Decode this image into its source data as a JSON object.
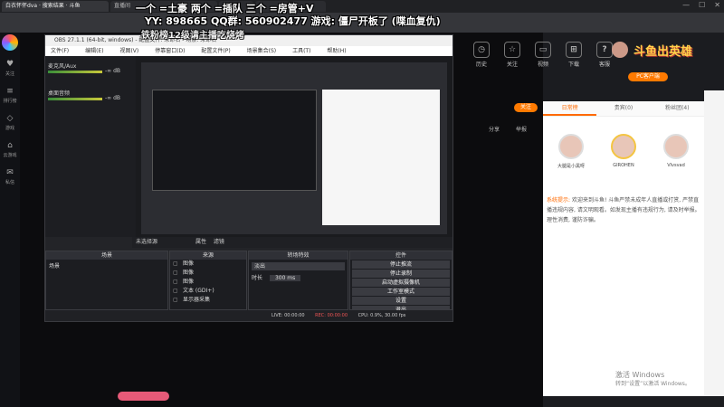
{
  "browser": {
    "tabs": [
      "白衣怀怀dva · 搜索结果 · 斗鱼",
      "直播间",
      "",
      "",
      "",
      "",
      ""
    ],
    "window_controls": [
      "—",
      "☐",
      "✕"
    ]
  },
  "overlay": {
    "line1": "一个 =土豪 两个 =插队 三个 =房管+V",
    "line2": "YY: 898665   QQ群: 560902477   游戏: 僵尸开板了 (喋血复仇)",
    "line3": "铁粉榜12级请主播吃烧烤"
  },
  "left_nav": {
    "items": [
      {
        "icon": "♥",
        "label": "关注"
      },
      {
        "icon": "≡",
        "label": "排行榜"
      },
      {
        "icon": "◇",
        "label": "游戏"
      },
      {
        "icon": "⌂",
        "label": "云游戏"
      },
      {
        "icon": "✉",
        "label": "私信"
      }
    ]
  },
  "top_icons": [
    {
      "icon": "◷",
      "label": "历史"
    },
    {
      "icon": "☆",
      "label": "关注"
    },
    {
      "icon": "▭",
      "label": "视频"
    },
    {
      "icon": "⊞",
      "label": "下载"
    },
    {
      "icon": "?",
      "label": "客服"
    }
  ],
  "brand_logo": "斗鱼出英雄",
  "obs": {
    "title": "OBS 27.1.1 (64-bit, windows) - 配置文件: 未命名 - 场景: 未命名",
    "menu": [
      "文件(F)",
      "编辑(E)",
      "视图(V)",
      "停靠窗口(D)",
      "配置文件(P)",
      "场景集合(S)",
      "工具(T)",
      "帮助(H)"
    ],
    "audio_labels": [
      "麦克风/Aux",
      "桌面音频"
    ],
    "audio_values": [
      "-∞ dB",
      "-∞ dB"
    ],
    "scene_label_bar": "未选择源",
    "scene_bar_actions": [
      "属性",
      "滤镜"
    ],
    "docks": {
      "scenes": {
        "title": "场景",
        "items": [
          "场景"
        ]
      },
      "sources": {
        "title": "来源",
        "items": [
          "图像",
          "图像",
          "图像",
          "文本 (GDI+)",
          "显示器采集"
        ]
      },
      "transitions": {
        "title": "转场特效",
        "mode": "淡出",
        "duration_label": "时长",
        "duration": "300 ms"
      },
      "controls": {
        "title": "控件",
        "buttons": [
          "停止推流",
          "停止录制",
          "启动虚拟摄像机",
          "工作室模式",
          "设置",
          "退出"
        ]
      }
    },
    "status": {
      "live": "LIVE: 00:00:00",
      "rec": "REC: 00:00:00",
      "cpu": "CPU: 0.9%, 30.00 fps"
    }
  },
  "right_panel": {
    "tabs": [
      "日常榜",
      "贵宾(0)",
      "粉丝团(4)"
    ],
    "ranks": [
      {
        "name": "大腿是小黑呀"
      },
      {
        "name": "GIROHEN"
      },
      {
        "name": "Vlvsvad"
      }
    ],
    "notice_heading": "系统提示:",
    "notice_text": "欢迎来到斗鱼! 斗鱼严禁未成年人直播或打赏, 严禁直播违规内容, 请文明观看。如发现主播有违规行为, 请及时举报。理性消费, 谨防诈骗。"
  },
  "rbuttons": {
    "pc_app": "PC客户端",
    "follow": "关注",
    "share": "分享",
    "report": "举报"
  },
  "watermark": {
    "line1": "激活 Windows",
    "line2": "转到“设置”以激活 Windows。"
  }
}
